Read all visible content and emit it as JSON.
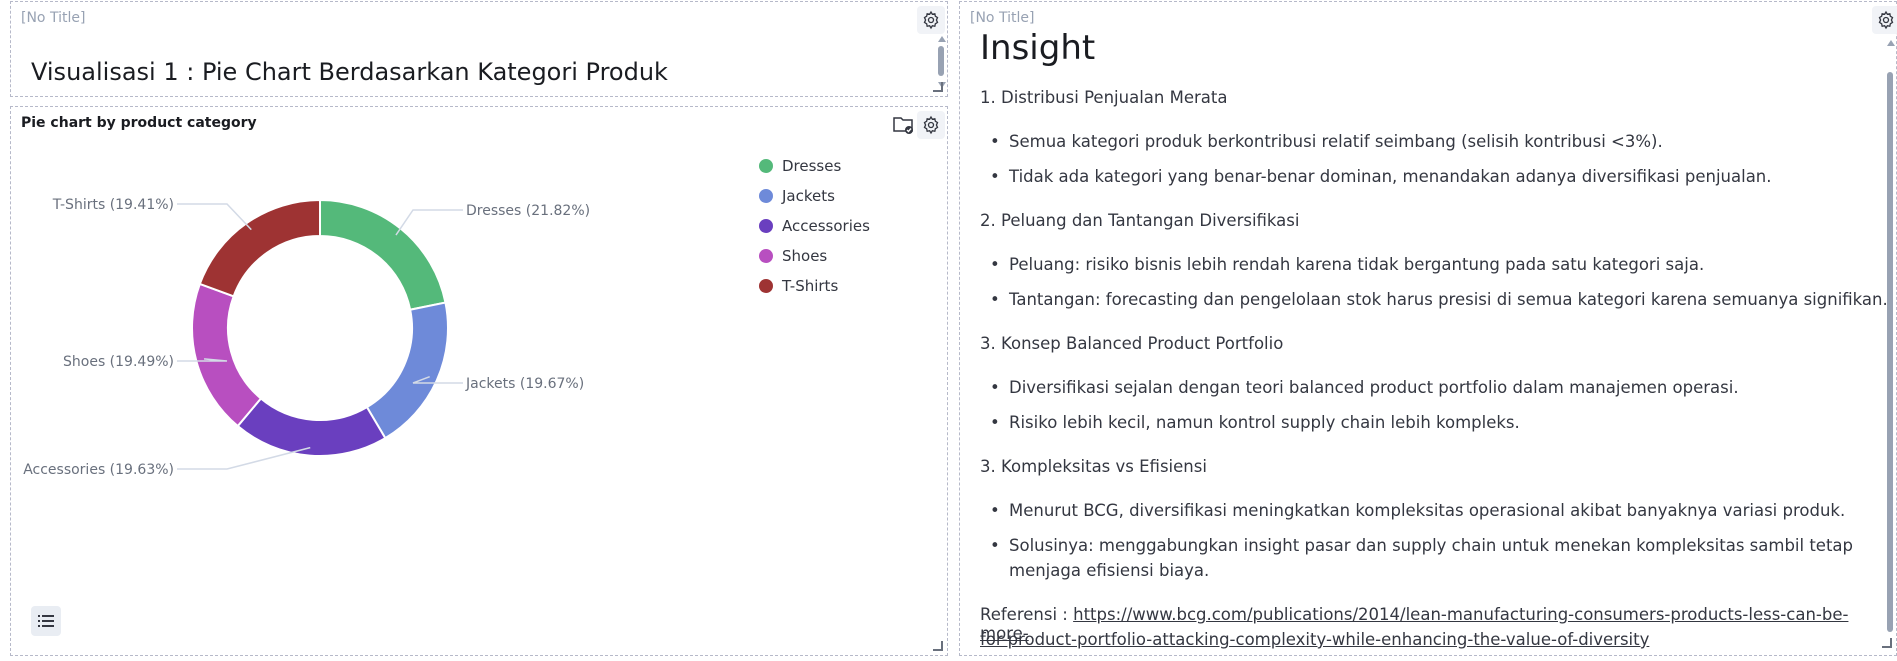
{
  "panel_title": {
    "header": "[No Title]",
    "text": "Visualisasi 1 : Pie Chart Berdasarkan Kategori Produk"
  },
  "panel_chart": {
    "title": "Pie chart by product category"
  },
  "panel_insight": {
    "header": "[No Title]",
    "heading": "Insight",
    "sections": [
      {
        "title": "1. Distribusi Penjualan Merata",
        "bullets": [
          "Semua kategori produk berkontribusi relatif seimbang (selisih kontribusi <3%).",
          "Tidak ada kategori yang benar-benar dominan, menandakan adanya diversifikasi penjualan."
        ]
      },
      {
        "title": "2. Peluang dan Tantangan Diversifikasi",
        "bullets": [
          "Peluang: risiko bisnis lebih rendah karena tidak bergantung pada satu kategori saja.",
          "Tantangan: forecasting dan pengelolaan stok harus presisi di semua kategori karena semuanya signifikan."
        ]
      },
      {
        "title": "3. Konsep Balanced Product Portfolio",
        "bullets": [
          "Diversifikasi sejalan dengan teori balanced product portfolio dalam manajemen operasi.",
          "Risiko lebih kecil, namun kontrol supply chain lebih kompleks."
        ]
      },
      {
        "title": "3. Kompleksitas vs Efisiensi",
        "bullets": [
          "Menurut BCG, diversifikasi meningkatkan kompleksitas operasional akibat banyaknya variasi produk.",
          "Solusinya: menggabungkan insight pasar dan supply chain untuk menekan kompleksitas sambil tetap",
          "menjaga efisiensi biaya."
        ]
      }
    ],
    "reference_label": "Referensi : ",
    "reference_url_line1": "https://www.bcg.com/publications/2014/lean-manufacturing-consumers-products-less-can-be-more-",
    "reference_url_line2": "for-product-portfolio-attacking-complexity-while-enhancing-the-value-of-diversity"
  },
  "icons": {
    "gear": "gear-icon",
    "folder_check": "folder-check-icon",
    "list": "list-icon"
  },
  "chart_data": {
    "type": "pie",
    "donut": true,
    "title": "Pie chart by product category",
    "legend_position": "right",
    "slices": [
      {
        "label": "Dresses",
        "value": 21.82,
        "color": "#54b97a",
        "text": "Dresses (21.82%)"
      },
      {
        "label": "Jackets",
        "value": 19.67,
        "color": "#6e8ad9",
        "text": "Jackets (19.67%)"
      },
      {
        "label": "Accessories",
        "value": 19.63,
        "color": "#6a3fbf",
        "text": "Accessories (19.63%)"
      },
      {
        "label": "Shoes",
        "value": 19.49,
        "color": "#b84fc0",
        "text": "Shoes (19.49%)"
      },
      {
        "label": "T-Shirts",
        "value": 19.41,
        "color": "#9e3333",
        "text": "T-Shirts (19.41%)"
      }
    ]
  }
}
